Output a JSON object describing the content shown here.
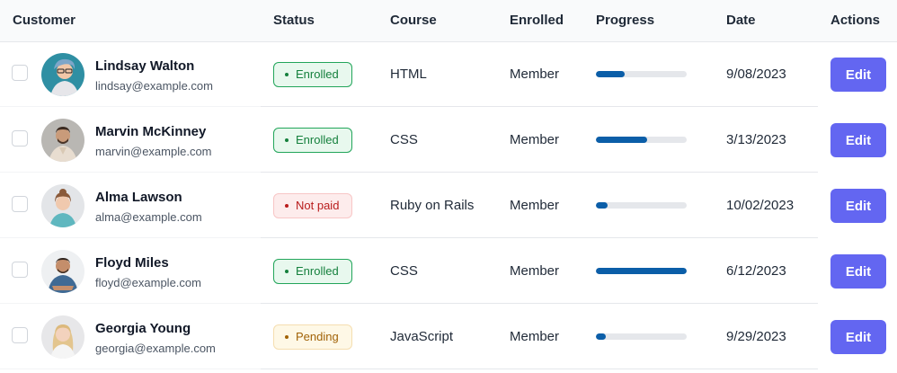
{
  "headers": {
    "customer": "Customer",
    "status": "Status",
    "course": "Course",
    "enrolled": "Enrolled",
    "progress": "Progress",
    "date": "Date",
    "actions": "Actions"
  },
  "colors": {
    "accent": "#6366f1",
    "progress": "#0b5ea8",
    "enrolled": "#15803d",
    "not_paid": "#b91c1c",
    "pending": "#a16207"
  },
  "rows": [
    {
      "name": "Lindsay Walton",
      "email": "lindsay@example.com",
      "status": "Enrolled",
      "status_kind": "enrolled",
      "course": "HTML",
      "enrolled": "Member",
      "progress": 0.32,
      "date": "9/08/2023",
      "action": "Edit",
      "checked": false
    },
    {
      "name": "Marvin McKinney",
      "email": "marvin@example.com",
      "status": "Enrolled",
      "status_kind": "enrolled",
      "course": "CSS",
      "enrolled": "Member",
      "progress": 0.56,
      "date": "3/13/2023",
      "action": "Edit",
      "checked": false
    },
    {
      "name": "Alma Lawson",
      "email": "alma@example.com",
      "status": "Not paid",
      "status_kind": "notpaid",
      "course": "Ruby on Rails",
      "enrolled": "Member",
      "progress": 0.13,
      "date": "10/02/2023",
      "action": "Edit",
      "checked": false
    },
    {
      "name": "Floyd Miles",
      "email": "floyd@example.com",
      "status": "Enrolled",
      "status_kind": "enrolled",
      "course": "CSS",
      "enrolled": "Member",
      "progress": 1.0,
      "date": "6/12/2023",
      "action": "Edit",
      "checked": false
    },
    {
      "name": "Georgia Young",
      "email": "georgia@example.com",
      "status": "Pending",
      "status_kind": "pending",
      "course": "JavaScript",
      "enrolled": "Member",
      "progress": 0.11,
      "date": "9/29/2023",
      "action": "Edit",
      "checked": false
    }
  ]
}
